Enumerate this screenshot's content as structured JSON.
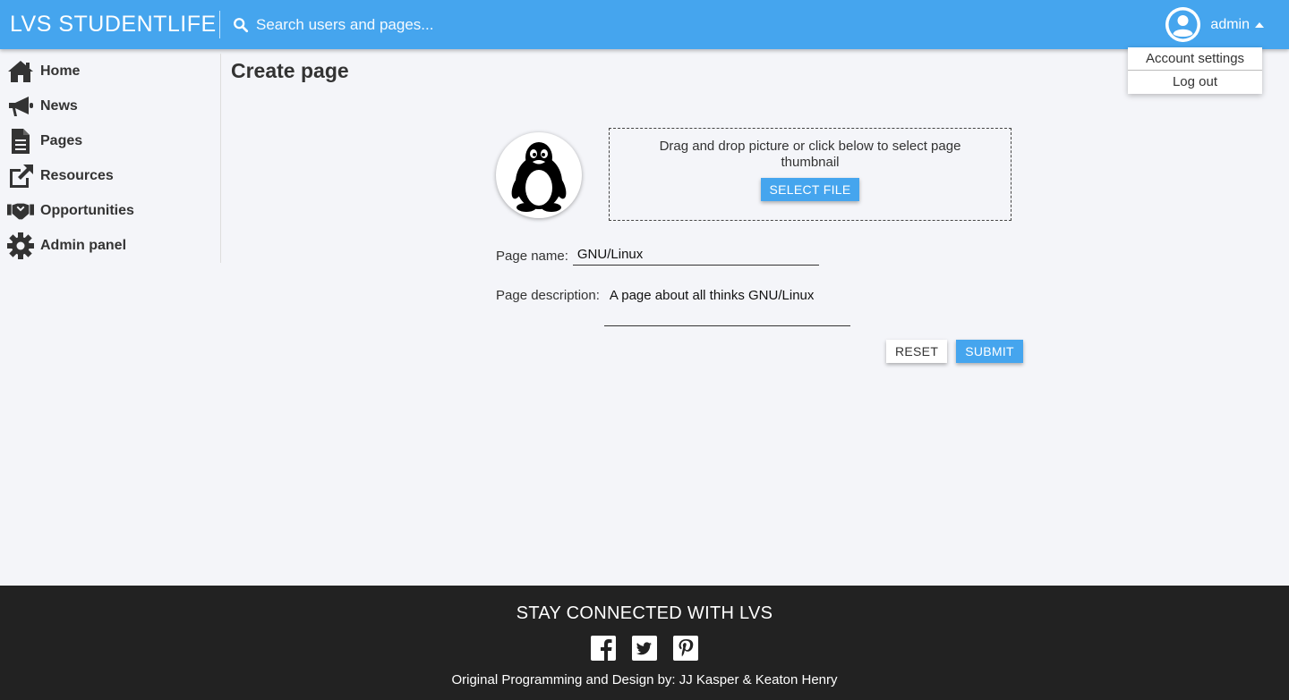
{
  "header": {
    "brand": "LVS STUDENTLIFE",
    "search_placeholder": "Search users and pages...",
    "username": "admin",
    "accent_color": "#45a5ee"
  },
  "user_menu": {
    "items": [
      "Account settings",
      "Log out"
    ]
  },
  "sidebar": {
    "items": [
      {
        "label": "Home",
        "icon": "home-icon"
      },
      {
        "label": "News",
        "icon": "megaphone-icon"
      },
      {
        "label": "Pages",
        "icon": "document-icon"
      },
      {
        "label": "Resources",
        "icon": "external-link-icon"
      },
      {
        "label": "Opportunities",
        "icon": "handshake-icon"
      },
      {
        "label": "Admin panel",
        "icon": "gear-icon"
      }
    ]
  },
  "main": {
    "title": "Create page",
    "dropzone_text": "Drag and drop picture or click below to select page thumbnail",
    "select_file_label": "SELECT FILE",
    "page_name_label": "Page name:",
    "page_name_value": "GNU/Linux",
    "page_description_label": "Page description:",
    "page_description_value": "A page about all thinks GNU/Linux",
    "reset_label": "RESET",
    "submit_label": "SUBMIT",
    "thumbnail_icon": "tux-penguin-icon"
  },
  "footer": {
    "heading": "STAY CONNECTED WITH LVS",
    "socials": [
      "facebook-icon",
      "twitter-icon",
      "pinterest-icon"
    ],
    "credit": "Original Programming and Design by: JJ Kasper & Keaton Henry"
  }
}
